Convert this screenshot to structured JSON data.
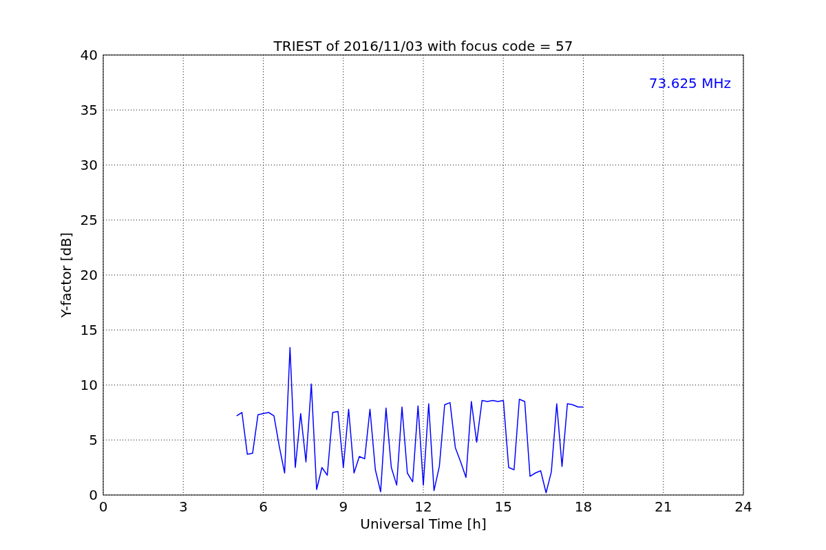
{
  "chart_data": {
    "type": "line",
    "title": "TRIEST of 2016/11/03 with focus code = 57",
    "xlabel": "Universal Time [h]",
    "ylabel": "Y-factor [dB]",
    "x": [
      5.0,
      5.2,
      5.4,
      5.6,
      5.8,
      6.0,
      6.2,
      6.4,
      6.6,
      6.8,
      7.0,
      7.2,
      7.4,
      7.6,
      7.8,
      8.0,
      8.2,
      8.4,
      8.6,
      8.8,
      9.0,
      9.2,
      9.4,
      9.6,
      9.8,
      10.0,
      10.2,
      10.4,
      10.6,
      10.8,
      11.0,
      11.2,
      11.4,
      11.6,
      11.8,
      12.0,
      12.2,
      12.4,
      12.6,
      12.8,
      13.0,
      13.2,
      13.4,
      13.6,
      13.8,
      14.0,
      14.2,
      14.4,
      14.6,
      14.8,
      15.0,
      15.2,
      15.4,
      15.6,
      15.8,
      16.0,
      16.2,
      16.4,
      16.6,
      16.8,
      17.0,
      17.2,
      17.4,
      17.6,
      17.8,
      18.0
    ],
    "series": [
      {
        "name": "73.625 MHz",
        "color": "#0000ff",
        "values": [
          7.2,
          7.5,
          3.7,
          3.8,
          7.3,
          7.4,
          7.5,
          7.2,
          4.4,
          2.0,
          13.4,
          2.5,
          7.4,
          3.0,
          10.1,
          0.5,
          2.5,
          1.8,
          7.5,
          7.6,
          2.5,
          7.8,
          2.0,
          3.5,
          3.3,
          7.8,
          2.3,
          0.3,
          7.9,
          2.5,
          0.9,
          8.0,
          2.0,
          1.2,
          8.1,
          0.9,
          8.3,
          0.4,
          2.6,
          8.2,
          8.4,
          4.3,
          3.0,
          1.6,
          8.5,
          4.8,
          8.6,
          8.5,
          8.6,
          8.5,
          8.6,
          2.5,
          2.3,
          8.7,
          8.5,
          1.7,
          2.0,
          2.2,
          0.2,
          2.1,
          8.3,
          2.6,
          8.3,
          8.2,
          8.0,
          8.0
        ]
      }
    ],
    "grid": true,
    "xlim": [
      0,
      24
    ],
    "ylim": [
      0,
      40
    ],
    "xticks": [
      0,
      3,
      6,
      9,
      12,
      15,
      18,
      21,
      24
    ],
    "yticks": [
      0,
      5,
      10,
      15,
      20,
      25,
      30,
      35,
      40
    ]
  }
}
